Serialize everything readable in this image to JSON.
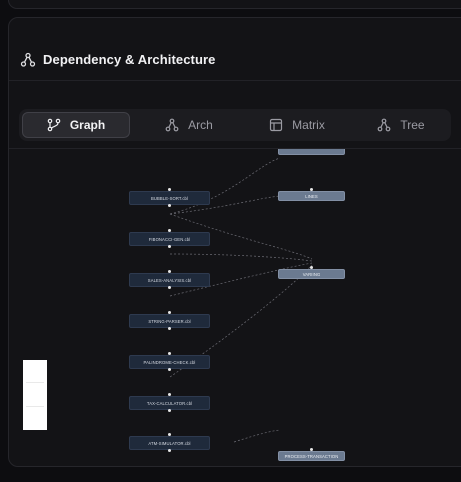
{
  "panel": {
    "title": "Dependency & Architecture"
  },
  "tabs": [
    {
      "label": "Graph",
      "icon": "graph-icon",
      "active": true
    },
    {
      "label": "Arch",
      "icon": "arch-icon",
      "active": false
    },
    {
      "label": "Matrix",
      "icon": "matrix-icon",
      "active": false
    },
    {
      "label": "Tree",
      "icon": "tree-icon",
      "active": false
    }
  ],
  "graph": {
    "source_nodes": [
      "BUBBLE-SORT.cbl",
      "FIBONACCI-GEN.cbl",
      "SALES-ANALYSIS.cbl",
      "STRING-PARSER.cbl",
      "PALINDROME-CHECK.cbl",
      "TAX-CALCULATOR.cbl",
      "ATM-SIMULATOR.cbl"
    ],
    "target_nodes": [
      "",
      "LINES",
      "VARIING",
      "PROCESS-TRANSACTION"
    ]
  },
  "colors": {
    "background": "#0d0d10",
    "panel": "#131316",
    "node": "#1f2a3b",
    "target_node": "#6b7a90"
  }
}
